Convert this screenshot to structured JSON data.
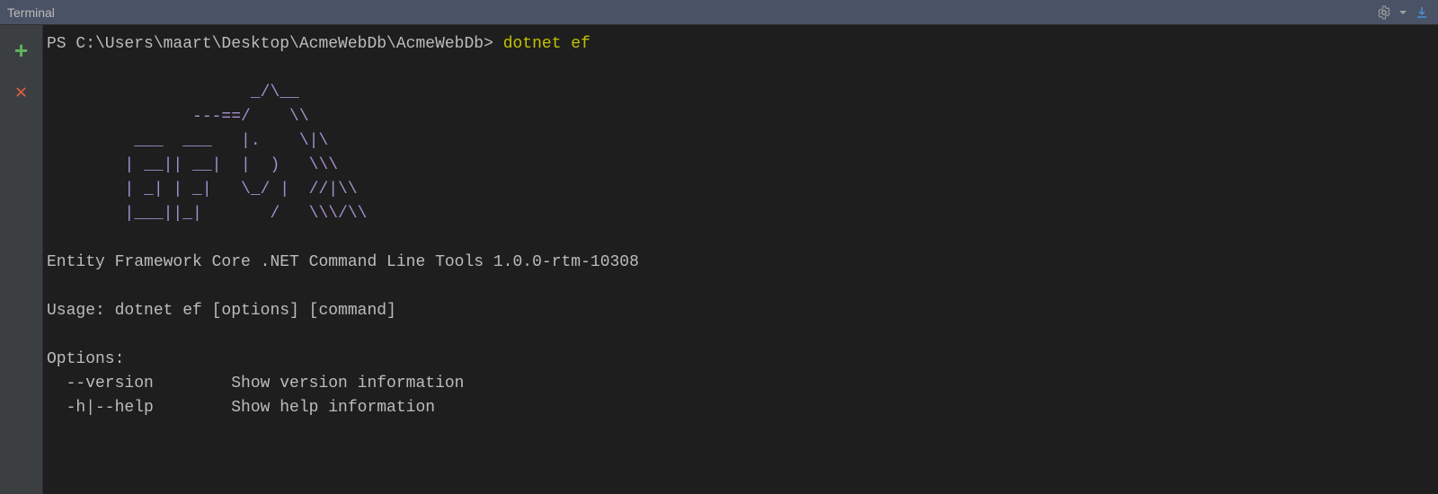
{
  "title": "Terminal",
  "prompt": "PS C:\\Users\\maart\\Desktop\\AcmeWebDb\\AcmeWebDb> ",
  "command": "dotnet ef",
  "ascii_art": "                     _/\\__\n               ---==/    \\\\\n         ___  ___   |.    \\|\\\n        | __|| __|  |  )   \\\\\\\n        | _| | _|   \\_/ |  //|\\\\\n        |___||_|       /   \\\\\\/\\\\",
  "description": "Entity Framework Core .NET Command Line Tools 1.0.0-rtm-10308",
  "usage": "Usage: dotnet ef [options] [command]",
  "options_header": "Options:",
  "option1": "  --version        Show version information",
  "option2": "  -h|--help        Show help information"
}
